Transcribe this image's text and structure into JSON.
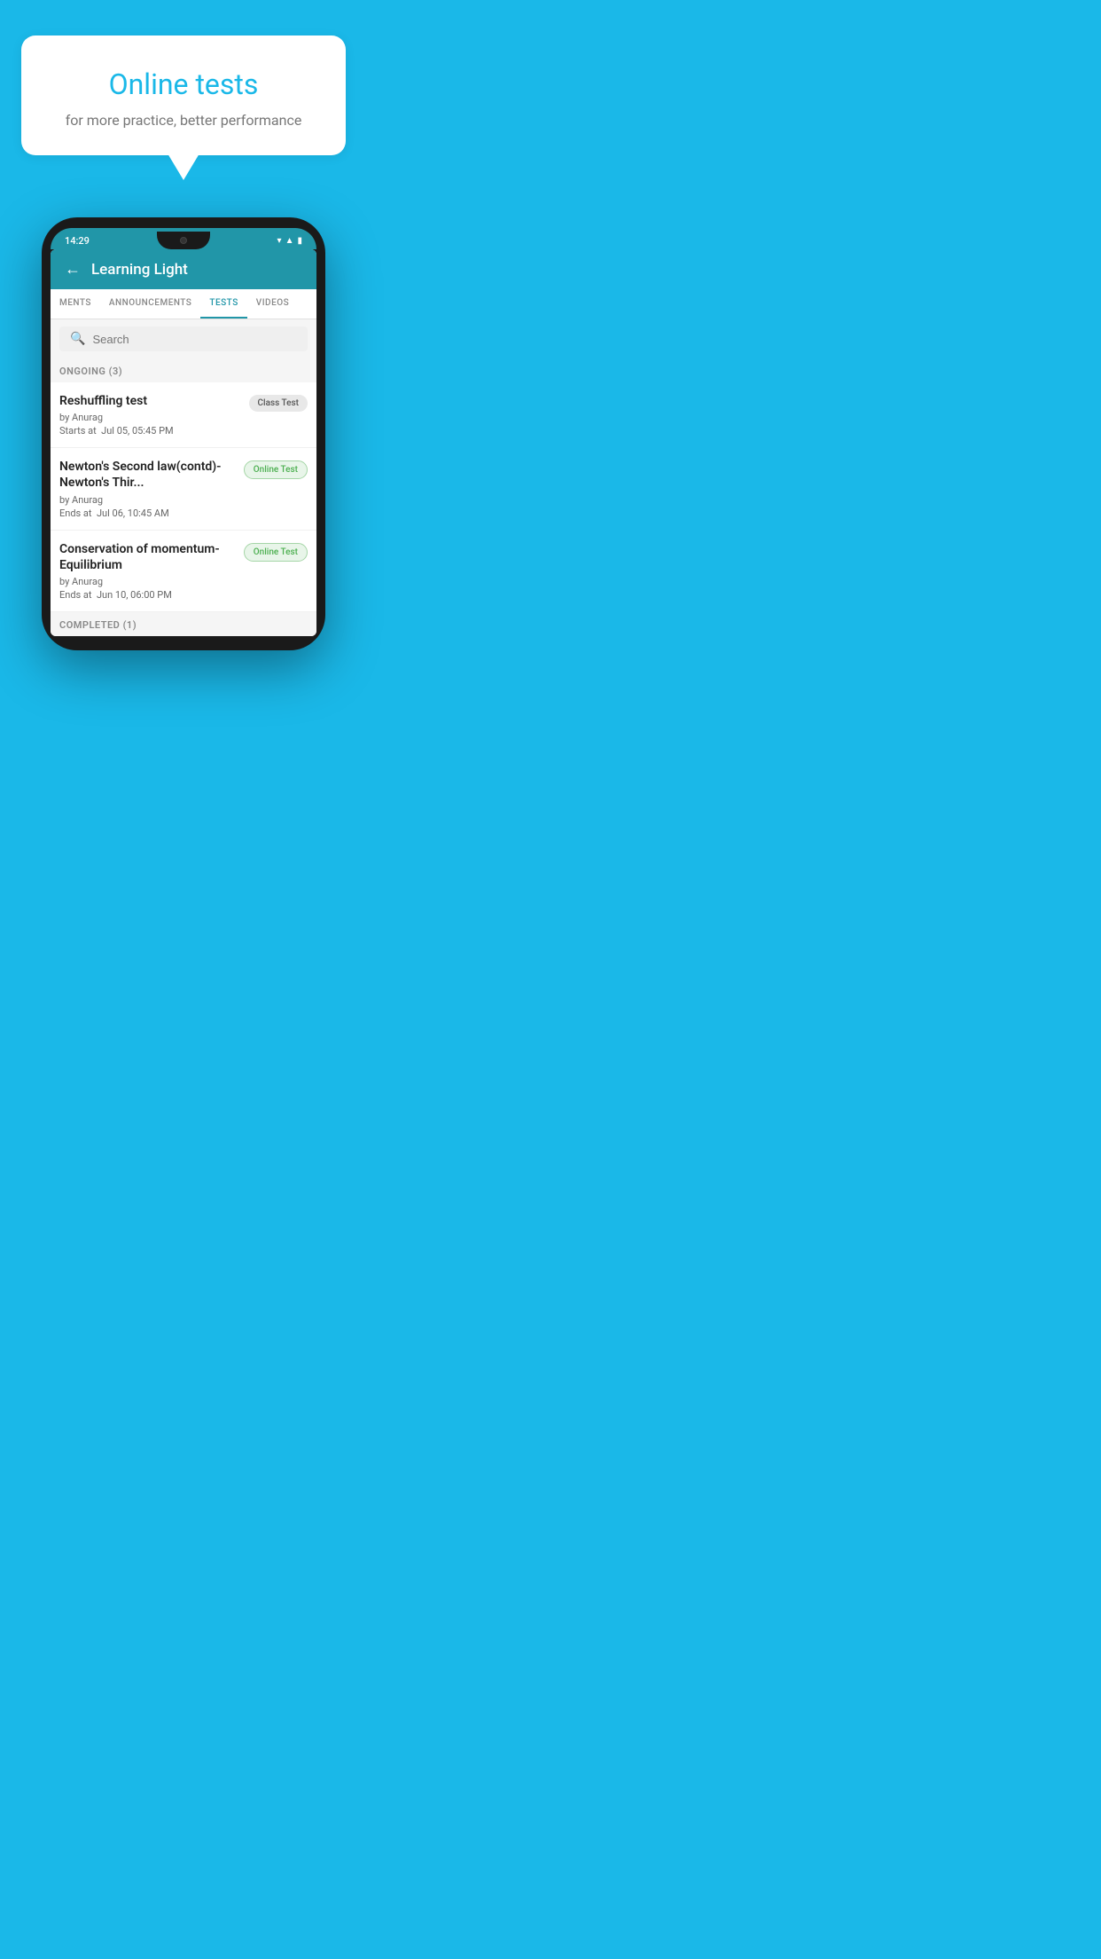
{
  "background_color": "#1AB8E8",
  "speech_bubble": {
    "title": "Online tests",
    "subtitle": "for more practice, better performance"
  },
  "phone": {
    "status_bar": {
      "time": "14:29"
    },
    "app_bar": {
      "back_label": "←",
      "title": "Learning Light"
    },
    "tabs": [
      {
        "label": "MENTS",
        "active": false
      },
      {
        "label": "ANNOUNCEMENTS",
        "active": false
      },
      {
        "label": "TESTS",
        "active": true
      },
      {
        "label": "VIDEOS",
        "active": false
      }
    ],
    "search": {
      "placeholder": "Search"
    },
    "ongoing_section": {
      "header": "ONGOING (3)"
    },
    "tests": [
      {
        "name": "Reshuffling test",
        "author": "by Anurag",
        "date_label": "Starts at",
        "date": "Jul 05, 05:45 PM",
        "badge": "Class Test",
        "badge_type": "class"
      },
      {
        "name": "Newton's Second law(contd)-Newton's Thir...",
        "author": "by Anurag",
        "date_label": "Ends at",
        "date": "Jul 06, 10:45 AM",
        "badge": "Online Test",
        "badge_type": "online"
      },
      {
        "name": "Conservation of momentum-Equilibrium",
        "author": "by Anurag",
        "date_label": "Ends at",
        "date": "Jun 10, 06:00 PM",
        "badge": "Online Test",
        "badge_type": "online"
      }
    ],
    "completed_section": {
      "header": "COMPLETED (1)"
    }
  }
}
